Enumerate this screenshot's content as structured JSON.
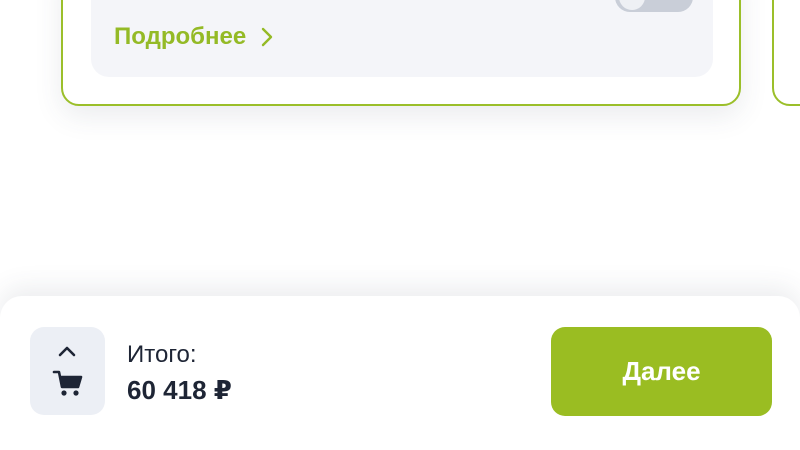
{
  "card": {
    "more_label": "Подробнее",
    "more_icon": "chevron-right-icon",
    "toggle_state": "off"
  },
  "summary": {
    "total_label": "Итого:",
    "total_amount": "60 418 ₽",
    "cart_icon": "cart-icon",
    "expand_icon": "chevron-up-icon"
  },
  "actions": {
    "next_label": "Далее"
  },
  "colors": {
    "accent": "#9abd22",
    "card_border": "#9bbf2a",
    "card_inner_bg": "#f4f5f9",
    "cart_button_bg": "#eceff5",
    "text_dark": "#1e2535"
  }
}
